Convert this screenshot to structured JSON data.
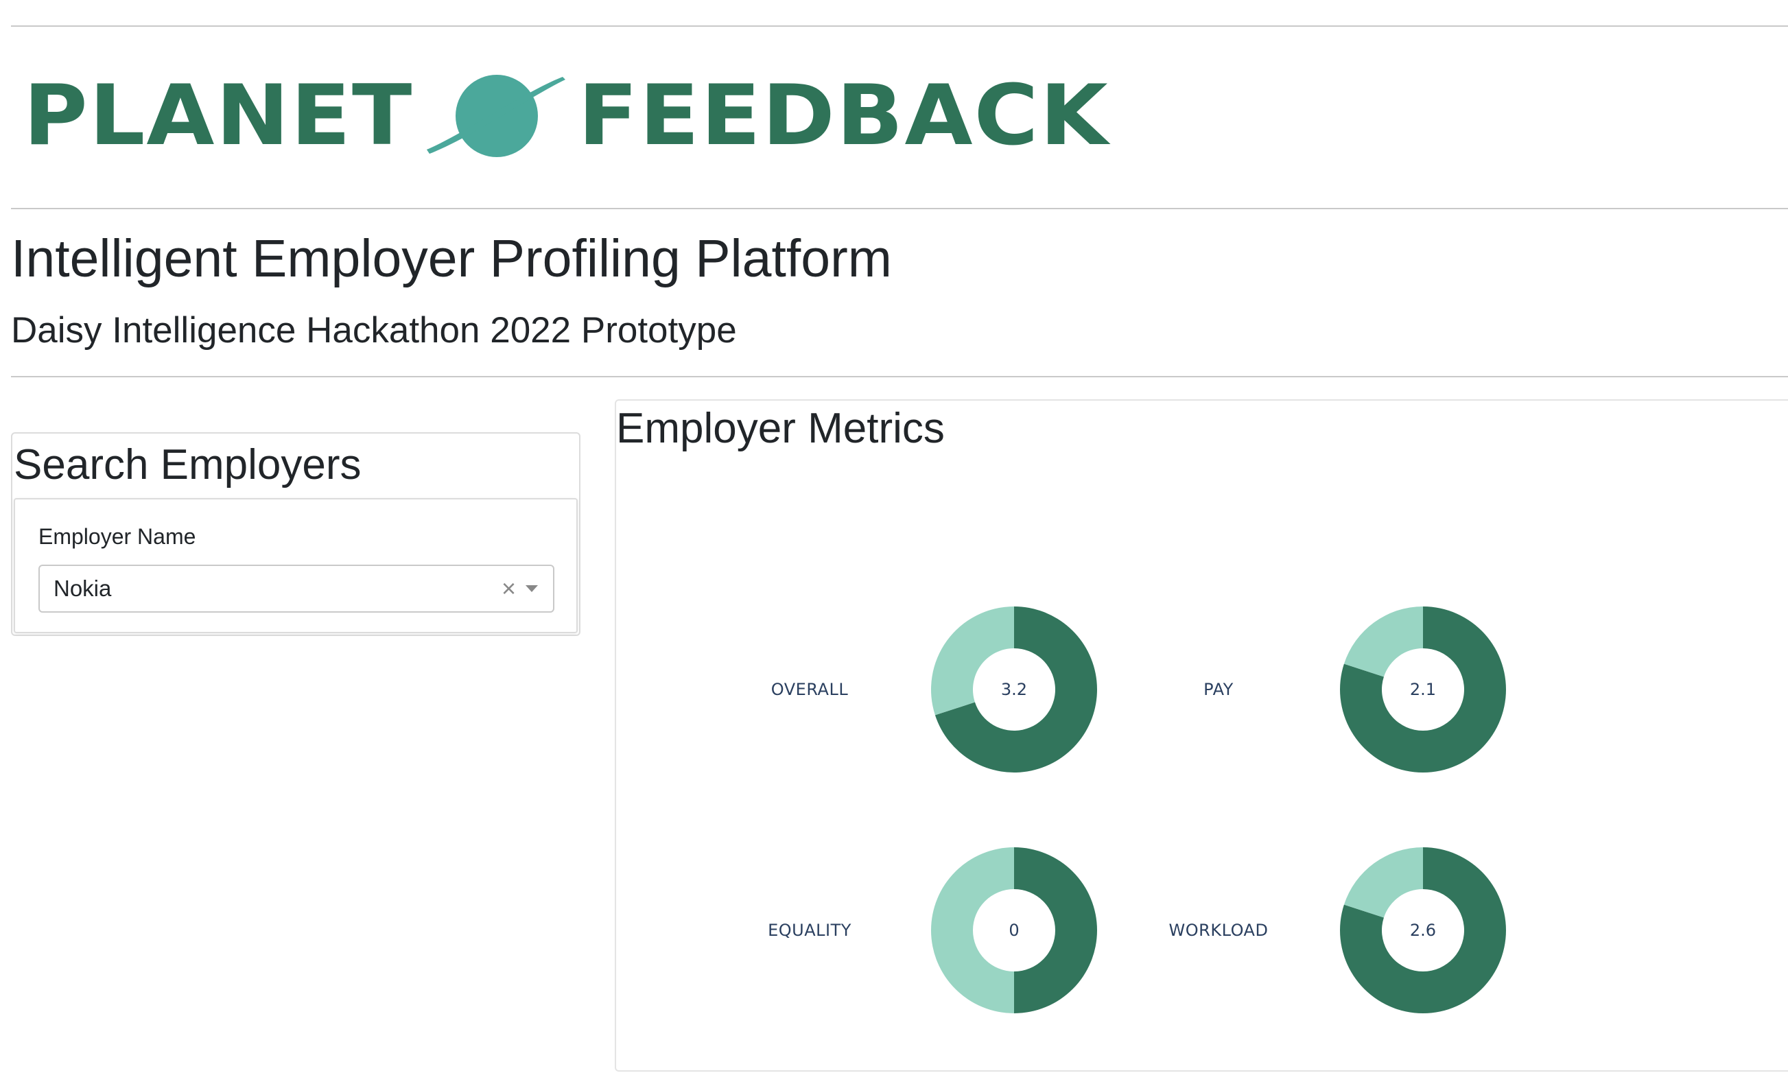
{
  "header": {
    "logo_left": "PLANET",
    "logo_right": "FEEDBACK",
    "logo_icon": "planet-icon",
    "title": "Intelligent Employer Profiling Platform",
    "subtitle": "Daisy Intelligence Hackathon 2022 Prototype"
  },
  "search": {
    "title": "Search Employers",
    "field_label": "Employer Name",
    "selected_value": "Nokia",
    "clear_icon": "close-icon",
    "dropdown_icon": "chevron-down-icon"
  },
  "metrics": {
    "title": "Employer Metrics",
    "colors": {
      "filled": "#32755c",
      "remainder": "#99d5c3"
    },
    "items": [
      {
        "label": "OVERALL",
        "value_text": "3.2",
        "fraction": 0.7
      },
      {
        "label": "PAY",
        "value_text": "2.1",
        "fraction": 0.8
      },
      {
        "label": "EQUALITY",
        "value_text": "0",
        "fraction": 0.5
      },
      {
        "label": "WORKLOAD",
        "value_text": "2.6",
        "fraction": 0.8
      }
    ]
  }
}
